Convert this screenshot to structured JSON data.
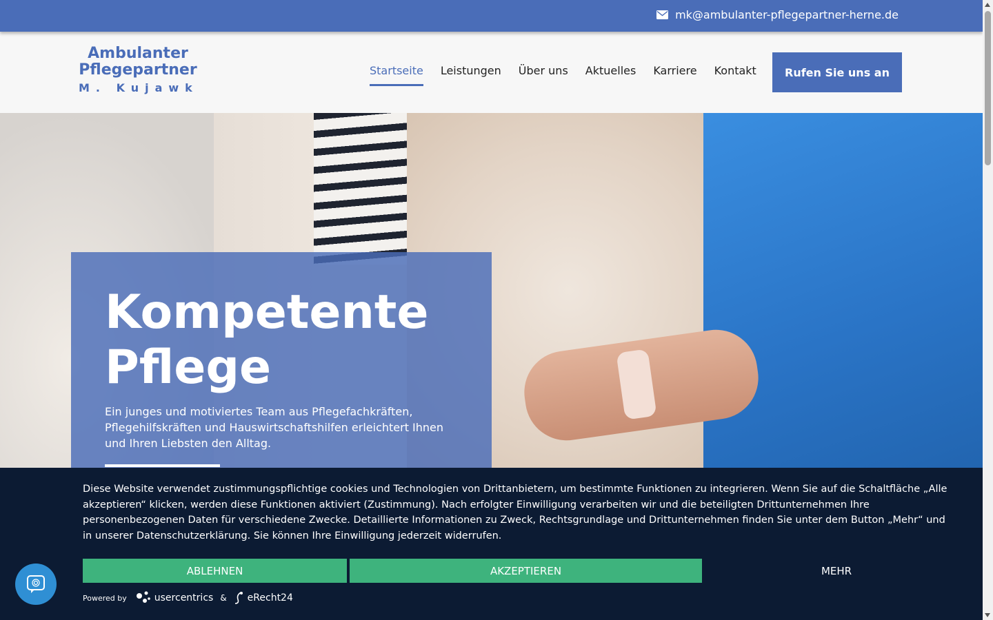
{
  "topbar": {
    "email": "mk@ambulanter-pflegepartner-herne.de",
    "email_icon": "envelope-icon"
  },
  "logo": {
    "line1": "Ambulanter",
    "line2": "Pflegepartner",
    "line3": "M. Kujawka"
  },
  "nav": {
    "items": [
      {
        "label": "Startseite",
        "active": true
      },
      {
        "label": "Leistungen",
        "active": false
      },
      {
        "label": "Über uns",
        "active": false
      },
      {
        "label": "Aktuelles",
        "active": false
      },
      {
        "label": "Karriere",
        "active": false
      },
      {
        "label": "Kontakt",
        "active": false
      }
    ],
    "cta_label": "Rufen Sie uns an"
  },
  "hero": {
    "title_line1": "Kompetente",
    "title_line2": "Pflege",
    "text": "Ein junges und motiviertes Team aus Pflegefachkräften, Pflegehilfskräften und Hauswirtschaftshilfen erleichtert Ihnen und Ihren Liebsten den Alltag."
  },
  "cookie": {
    "text": "Diese Website verwendet zustimmungspflichtige cookies und Technologien von Drittanbietern, um bestimmte Funktionen zu integrieren. Wenn Sie auf die Schaltfläche „Alle akzeptieren“ klicken, werden diese Funktionen aktiviert (Zustimmung). Nach erfolgter Einwilligung verarbeiten wir und die beteiligten Drittunternehmen Ihre personenbezogenen Daten für verschiedene Zwecke. Detaillierte Informationen zu Zweck, Rechtsgrundlage und Drittunternehmen finden Sie unter dem Button „Mehr“ und in unserer Datenschutzerklärung. Sie können Ihre Einwilligung jederzeit widerrufen.",
    "decline_label": "ABLEHNEN",
    "accept_label": "AKZEPTIEREN",
    "more_label": "MEHR",
    "powered_by": "Powered by",
    "brand1": "usercentrics",
    "amp": "&",
    "brand2": "eRecht24"
  },
  "colors": {
    "primary": "#4a6db8",
    "cookie_bg": "#0c1b33",
    "cookie_btn": "#3eb37d"
  }
}
